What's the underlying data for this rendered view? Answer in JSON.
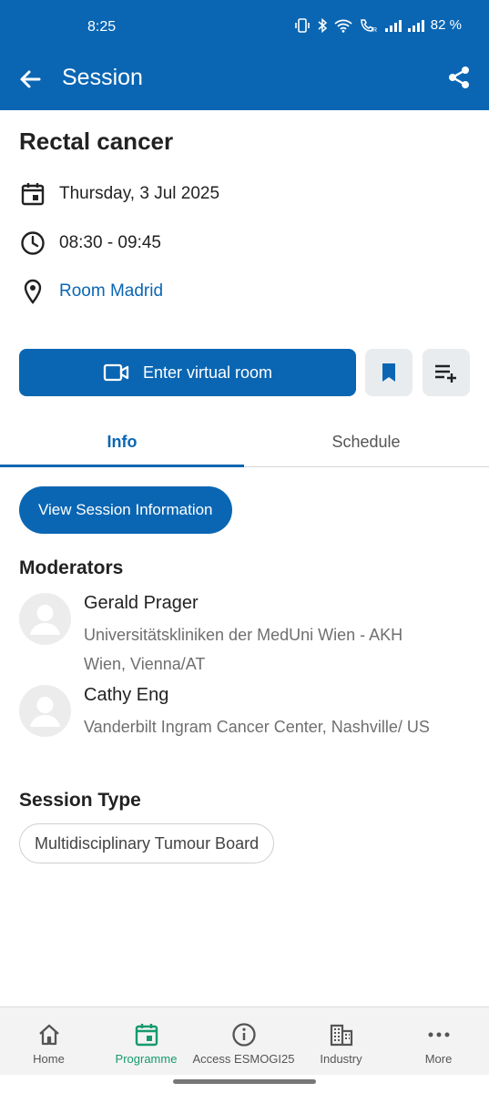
{
  "status_bar": {
    "time": "8:25",
    "battery": "82 %"
  },
  "app_bar": {
    "title": "Session"
  },
  "session": {
    "title": "Rectal cancer",
    "date": "Thursday, 3 Jul 2025",
    "time": "08:30 - 09:45",
    "room": "Room Madrid"
  },
  "actions": {
    "enter_virtual_room": "Enter virtual room"
  },
  "tabs": [
    {
      "label": "Info",
      "active": true
    },
    {
      "label": "Schedule",
      "active": false
    }
  ],
  "info": {
    "view_session_button": "View Session Information",
    "moderators_heading": "Moderators",
    "moderators": [
      {
        "name": "Gerald Prager",
        "affiliation": "Universitätskliniken der MedUni Wien - AKH Wien, Vienna/AT"
      },
      {
        "name": "Cathy Eng",
        "affiliation": "Vanderbilt Ingram Cancer Center, Nashville/ US"
      }
    ],
    "session_type_heading": "Session Type",
    "session_type": "Multidisciplinary Tumour Board"
  },
  "bottom_nav": [
    {
      "label": "Home",
      "icon": "home-icon",
      "active": false
    },
    {
      "label": "Programme",
      "icon": "calendar-icon",
      "active": true
    },
    {
      "label": "Access ESMOGI25",
      "icon": "info-icon",
      "active": false
    },
    {
      "label": "Industry",
      "icon": "building-icon",
      "active": false
    },
    {
      "label": "More",
      "icon": "more-dots-icon",
      "active": false
    }
  ],
  "colors": {
    "primary": "#0a66b3",
    "nav_active": "#159a6c",
    "chip_border": "#cfcfcf"
  }
}
